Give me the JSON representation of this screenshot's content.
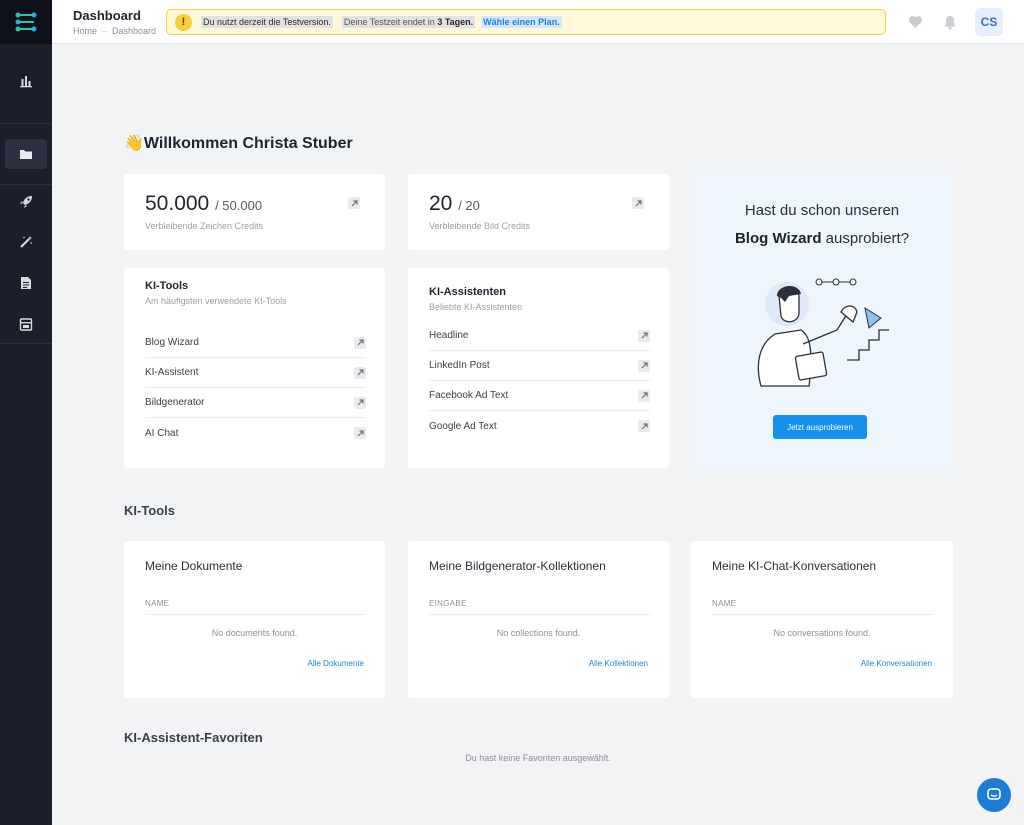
{
  "header": {
    "title": "Dashboard",
    "breadcrumb": [
      "Home",
      "Dashboard"
    ],
    "banner": {
      "part1": "Du nutzt derzeit die Testversion.",
      "part2_prefix": "Deine Testzeit endet in",
      "part2_strong": "3 Tagen.",
      "link": "Wähle einen Plan."
    },
    "avatar_initials": "CS"
  },
  "welcome": {
    "emoji": "👋",
    "text": "Willkommen Christa Stuber"
  },
  "credits": {
    "text": {
      "value": "50.000",
      "total": "/ 50.000",
      "label": "Verbleibende Zeichen Credits"
    },
    "image": {
      "value": "20",
      "total": "/ 20",
      "label": "Verbleibende Bild Credits"
    }
  },
  "tools_card": {
    "title": "KI-Tools",
    "subtitle": "Am häufigsten verwendete KI-Tools",
    "items": [
      "Blog Wizard",
      "KI-Assistent",
      "Bildgenerator",
      "AI Chat"
    ]
  },
  "assistants_card": {
    "title": "KI-Assistenten",
    "subtitle": "Beliebte KI-Assistenten",
    "items": [
      "Headline",
      "LinkedIn Post",
      "Facebook Ad Text",
      "Google Ad Text"
    ]
  },
  "promo": {
    "line1": "Hast du schon unseren",
    "line2_strong": "Blog Wizard",
    "line2_rest": "ausprobiert?",
    "button": "Jetzt ausprobieren"
  },
  "sections": {
    "tools": "KI-Tools",
    "favorites": "KI-Assistent-Favoriten",
    "favorites_empty": "Du hast keine Favoriten ausgewählt."
  },
  "documents": {
    "title": "Meine Dokumente",
    "column": "NAME",
    "empty": "No documents found.",
    "link": "Alle Dokumente"
  },
  "collections": {
    "title": "Meine Bildgenerator-Kollektionen",
    "column": "EINGABE",
    "empty": "No collections found.",
    "link": "Alle Kollektionen"
  },
  "conversations": {
    "title": "Meine KI-Chat-Konversationen",
    "column": "NAME",
    "empty": "No conversations found.",
    "link": "Alle Konversationen"
  },
  "icons": {
    "logo": "nodes-logo-icon",
    "nav": [
      "bar-chart-icon",
      "folder-icon",
      "rocket-icon",
      "magic-wand-icon",
      "document-icon",
      "archive-icon"
    ],
    "header": [
      "heart-icon",
      "bell-icon"
    ],
    "chat": "chat-bubble-icon"
  },
  "colors": {
    "accent": "#1690ec",
    "sidebar": "#1b1e2b",
    "banner_bg": "#fdf8d8",
    "banner_border": "#f0d34a",
    "promo_bg": "#eef5fc"
  }
}
